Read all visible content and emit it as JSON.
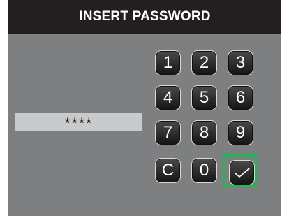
{
  "header": {
    "title": "INSERT PASSWORD"
  },
  "password": {
    "masked_value": "****"
  },
  "keypad": {
    "keys": [
      "1",
      "2",
      "3",
      "4",
      "5",
      "6",
      "7",
      "8",
      "9",
      "C",
      "0"
    ],
    "confirm_icon": "checkmark-icon"
  },
  "colors": {
    "header_bg": "#231f20",
    "screen_bg": "#7d7f81",
    "field_bg": "#c9cacb",
    "confirm_highlight": "#1db954"
  }
}
